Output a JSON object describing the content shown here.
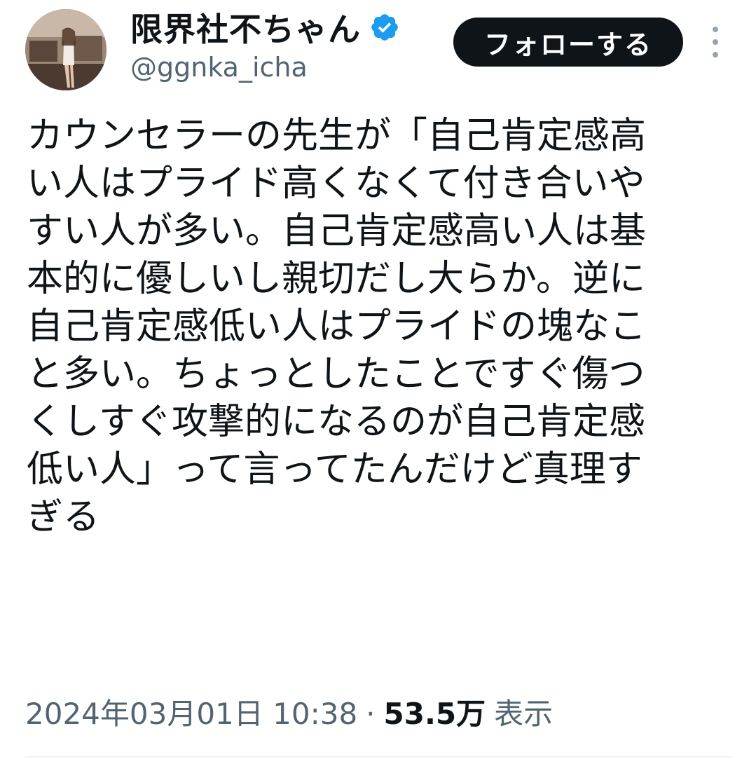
{
  "user": {
    "display_name": "限界社不ちゃん",
    "handle": "@ggnka_icha",
    "avatar_icon": "avatar-photo",
    "verified_icon": "verified-badge-icon",
    "verified_color": "#1d9bf0"
  },
  "actions": {
    "follow_label": "フォローする",
    "more_icon": "more-vertical-icon"
  },
  "tweet": {
    "lines": [
      "カウンセラーの先生が「自己肯定感高",
      "い人はプライド高くなくて付き合いや",
      "すい人が多い。自己肯定感高い人は基",
      "本的に優しいし親切だし大らか。逆に",
      "自己肯定感低い人はプライドの塊なこ",
      "と多い。ちょっとしたことですぐ傷つ",
      "くしすぐ攻撃的になるのが自己肯定感",
      "低い人」って言ってたんだけど真理す",
      "ぎる"
    ]
  },
  "meta": {
    "timestamp": "2024年03月01日 10:38",
    "separator": "·",
    "views_count": "53.5万",
    "views_label": "表示"
  },
  "colors": {
    "text_primary": "#0f1419",
    "text_secondary": "#536471",
    "follow_bg": "#0f1419",
    "follow_text": "#ffffff"
  }
}
